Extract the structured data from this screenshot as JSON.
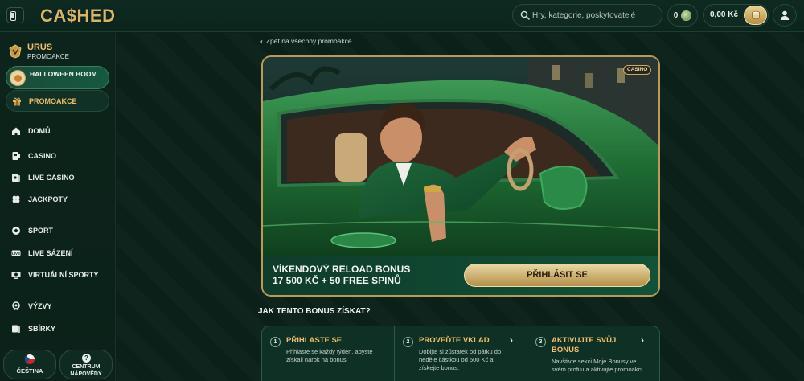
{
  "header": {
    "logo_text": "CA$HED",
    "search_placeholder": "Hry, kategorie, poskytovatelé",
    "coins_value": "0",
    "balance": "0,00 Kč"
  },
  "sidebar": {
    "promo_title": "URUS",
    "promo_subtitle": "PROMOAKCE",
    "halloween_label": "HALLOWEEN BOOM",
    "promoakce_label": "PROMOAKCE",
    "nav": [
      {
        "label": "DOMŮ",
        "icon": "home-icon"
      },
      {
        "label": "CASINO",
        "icon": "casino-icon"
      },
      {
        "label": "LIVE CASINO",
        "icon": "live-casino-icon"
      },
      {
        "label": "JACKPOTY",
        "icon": "clover-icon"
      },
      {
        "label": "SPORT",
        "icon": "ball-icon"
      },
      {
        "label": "LIVE SÁZENÍ",
        "icon": "live-betting-icon"
      },
      {
        "label": "VIRTUÁLNÍ SPORTY",
        "icon": "virtual-sports-icon"
      },
      {
        "label": "VÝZVY",
        "icon": "challenge-icon"
      },
      {
        "label": "SBÍRKY",
        "icon": "collection-icon"
      }
    ],
    "language_label": "ČEŠTINA",
    "help_label_1": "CENTRUM",
    "help_label_2": "NÁPOVĚDY"
  },
  "main": {
    "back_link": "Zpět na všechny promoakce",
    "casino_tag": "CASINO",
    "promo_title_line1": "VÍKENDOVÝ RELOAD BONUS",
    "promo_title_line2": "17 500 KČ + 50 FREE SPINŮ",
    "login_button": "PŘIHLÁSIT SE",
    "how_title": "JAK TENTO BONUS ZÍSKAT?",
    "steps": [
      {
        "num": "1",
        "title": "PŘIHLASTE SE",
        "desc": "Přihlaste se každý týden, abyste získali nárok na bonus."
      },
      {
        "num": "2",
        "title": "PROVEĎTE VKLAD",
        "desc": "Dobijte si zůstatek od pátku do neděle částkou od 500 Kč a získejte bonus."
      },
      {
        "num": "3",
        "title_1": "AKTIVUJTE SVŮJ",
        "title_2": "BONUS",
        "desc": "Navštivte sekci Moje Bonusy ve svém profilu a aktivujte promoakci."
      }
    ]
  },
  "colors": {
    "background": "#0b2119",
    "gold_accent": "#f0c06a",
    "button_gold": "#d7bd7c",
    "green_card": "#115238"
  }
}
